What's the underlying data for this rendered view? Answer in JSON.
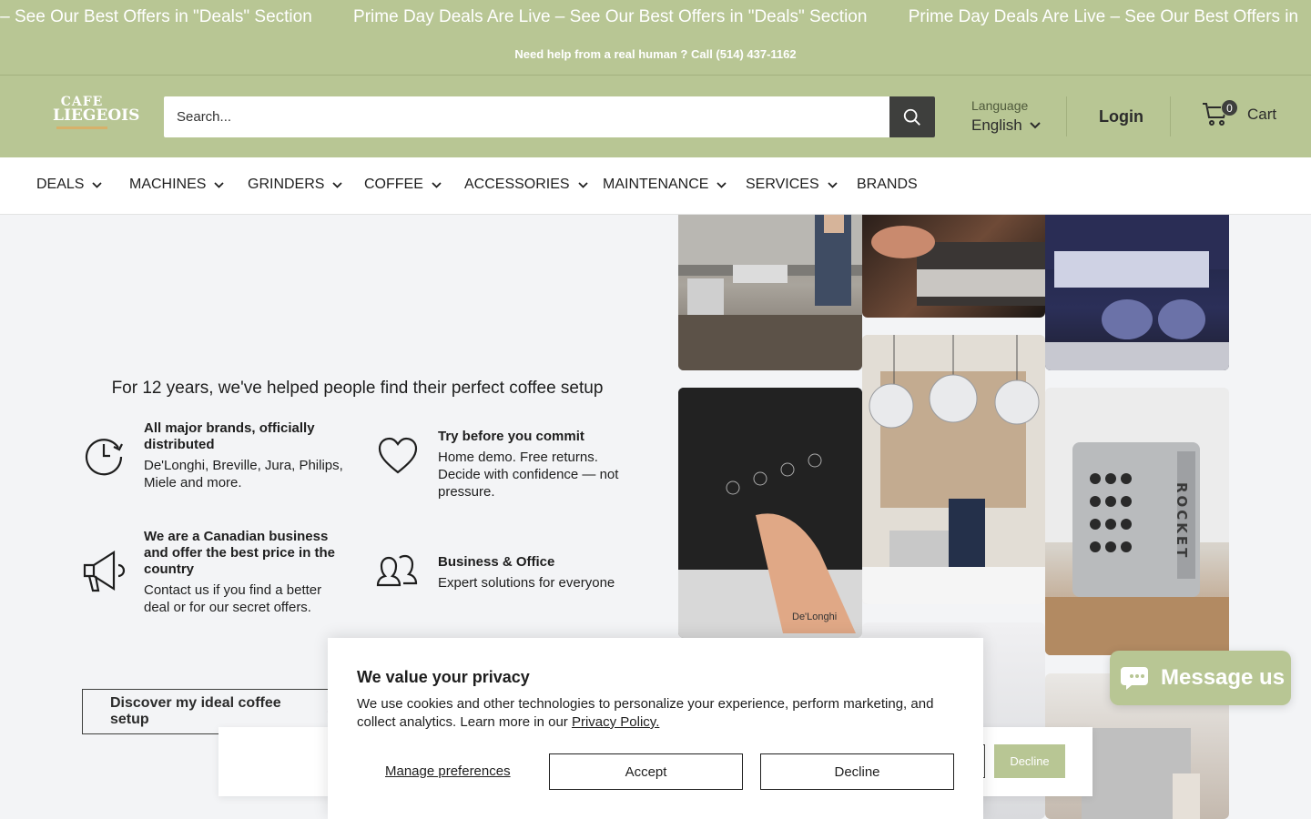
{
  "announcement": {
    "marquee": [
      "Live – See Our Best Offers in \"Deals\" Section",
      "Prime Day Deals Are Live – See Our Best Offers in \"Deals\" Section",
      "Prime Day Deals Are Live – See Our Best Offers in"
    ],
    "helpline": "Need help from a real human ? Call (514) 437-1162"
  },
  "header": {
    "logo_line1": "CAFE",
    "logo_line2": "LIEGEOIS",
    "search_placeholder": "Search...",
    "language_label": "Language",
    "language_value": "English",
    "login_label": "Login",
    "cart_count": "0",
    "cart_label": "Cart",
    "brand_color": "#b8c694"
  },
  "nav": {
    "items": [
      {
        "label": "DEALS",
        "dropdown": true
      },
      {
        "label": "MACHINES",
        "dropdown": true
      },
      {
        "label": "GRINDERS",
        "dropdown": true
      },
      {
        "label": "COFFEE",
        "dropdown": true
      },
      {
        "label": "ACCESSORIES",
        "dropdown": true
      },
      {
        "label": "MAINTENANCE",
        "dropdown": true
      },
      {
        "label": "SERVICES",
        "dropdown": true
      },
      {
        "label": "BRANDS",
        "dropdown": false
      }
    ]
  },
  "main": {
    "tagline": "For 12 years, we've helped people find their perfect coffee setup",
    "features": [
      {
        "icon": "clock-icon",
        "title": "All major brands, officially distributed",
        "desc": "De'Longhi, Breville, Jura, Philips, Miele and more."
      },
      {
        "icon": "heart-icon",
        "title": "Try before you commit",
        "desc": "Home demo. Free returns. Decide with confidence — not pressure."
      },
      {
        "icon": "megaphone-icon",
        "title": "We are a Canadian business and offer the best price in the country",
        "desc": "Contact us if you find a better deal or for our secret offers."
      },
      {
        "icon": "people-icon",
        "title": "Business & Office",
        "desc": "Expert solutions for everyone"
      }
    ],
    "cta_label": "Discover my ideal coffee setup"
  },
  "gallery": {
    "rocket_text": "ROCKET",
    "delonghi_text": "De'Longhi"
  },
  "cookie": {
    "title": "We value your privacy",
    "text": "We use cookies and other technologies to personalize your experience, perform marketing, and collect analytics. Learn more in our ",
    "policy_link": "Privacy Policy.",
    "manage_label": "Manage preferences",
    "accept_label": "Accept",
    "decline_label": "Decline"
  },
  "background_banner": {
    "decline_label": "Decline"
  },
  "chat": {
    "label": "Message us"
  }
}
